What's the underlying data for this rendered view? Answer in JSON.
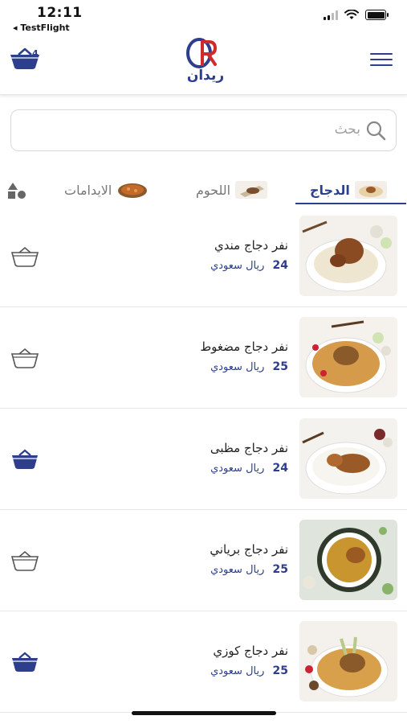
{
  "status_bar": {
    "time": "12:11",
    "back_app": "◂ TestFlight"
  },
  "header": {
    "cart_count": "4",
    "logo_text": "ريدان",
    "accent_color": "#2c3e8c"
  },
  "search": {
    "placeholder": "بحث"
  },
  "tabs": [
    {
      "label": "الدجاج",
      "active": true
    },
    {
      "label": "اللحوم",
      "active": false
    },
    {
      "label": "الايدامات",
      "active": false
    }
  ],
  "products": [
    {
      "name": "نفر دجاج مندي",
      "price": "24",
      "currency": "ريال سعودي",
      "in_cart": false
    },
    {
      "name": "نفر دجاج مضغوط",
      "price": "25",
      "currency": "ريال سعودي",
      "in_cart": false
    },
    {
      "name": "نفر دجاج مظبى",
      "price": "24",
      "currency": "ريال سعودي",
      "in_cart": true
    },
    {
      "name": "نفر دجاج برياني",
      "price": "25",
      "currency": "ريال سعودي",
      "in_cart": false
    },
    {
      "name": "نفر دجاج كوزي",
      "price": "25",
      "currency": "ريال سعودي",
      "in_cart": true
    }
  ]
}
